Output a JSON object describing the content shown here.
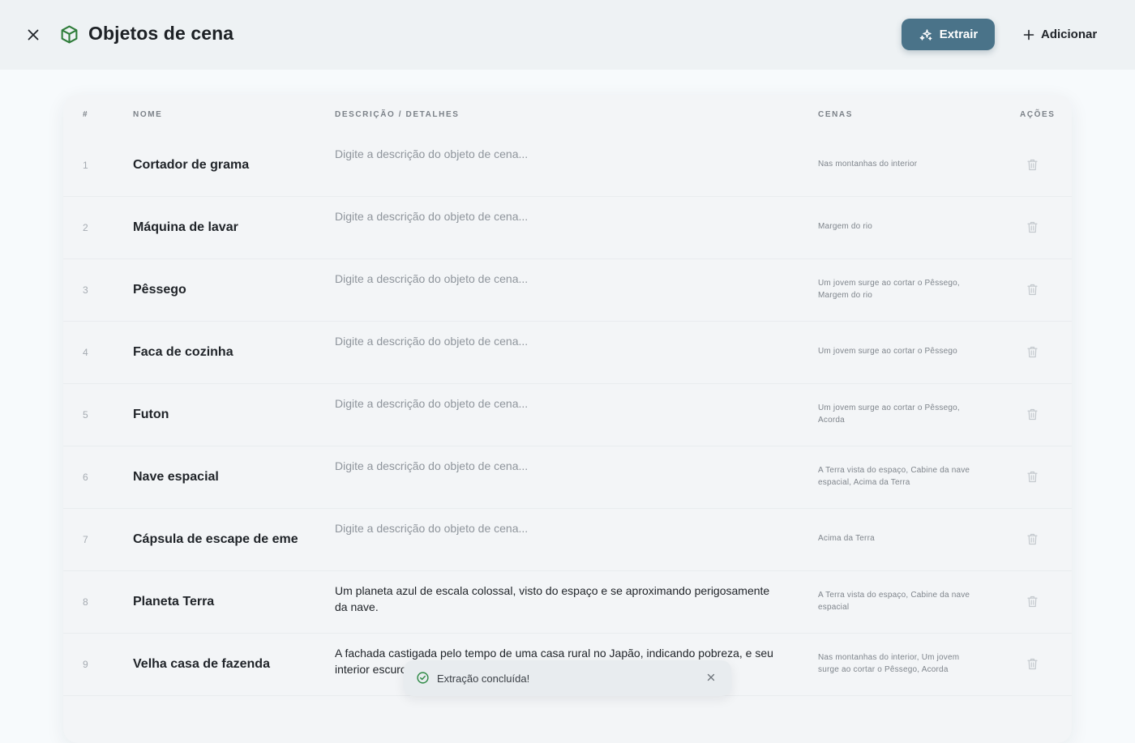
{
  "header": {
    "title": "Objetos de cena",
    "extract_label": "Extrair",
    "add_label": "Adicionar"
  },
  "colors": {
    "accent": "#4a7389",
    "title_icon": "#2f7d3a",
    "toast_icon": "#2f8a46"
  },
  "icons": {
    "close": "close-icon",
    "title": "cube-icon",
    "extract": "sparkles-icon",
    "add": "plus-icon",
    "delete": "trash-icon",
    "toast_status": "check-circle-icon",
    "toast_close": "close-icon"
  },
  "table": {
    "columns": {
      "index": "#",
      "name": "NOME",
      "description": "DESCRIÇÃO / DETALHES",
      "scenes": "CENAS",
      "actions": "AÇÕES"
    },
    "description_placeholder": "Digite a descrição do objeto de cena...",
    "rows": [
      {
        "index": "1",
        "name": "Cortador de grama",
        "description": "",
        "scenes": "Nas montanhas do interior"
      },
      {
        "index": "2",
        "name": "Máquina de lavar",
        "description": "",
        "scenes": "Margem do rio"
      },
      {
        "index": "3",
        "name": "Pêssego",
        "description": "",
        "scenes": "Um jovem surge ao cortar o Pêssego, Margem do rio"
      },
      {
        "index": "4",
        "name": "Faca de cozinha",
        "description": "",
        "scenes": "Um jovem surge ao cortar o Pêssego"
      },
      {
        "index": "5",
        "name": "Futon",
        "description": "",
        "scenes": "Um jovem surge ao cortar o Pêssego, Acorda"
      },
      {
        "index": "6",
        "name": "Nave espacial",
        "description": "",
        "scenes": "A Terra vista do espaço, Cabine da nave espacial, Acima da Terra"
      },
      {
        "index": "7",
        "name": "Cápsula de escape de emer",
        "description": "",
        "scenes": "Acima da Terra"
      },
      {
        "index": "8",
        "name": "Planeta Terra",
        "description": "Um planeta azul de escala colossal, visto do espaço e se aproximando perigosamente da nave.",
        "scenes": "A Terra vista do espaço, Cabine da nave espacial"
      },
      {
        "index": "9",
        "name": "Velha casa de fazenda",
        "description": "A fachada castigada pelo tempo de uma casa rural no Japão, indicando pobreza, e seu interior escuro",
        "scenes": "Nas montanhas do interior, Um jovem surge ao cortar o Pêssego, Acorda"
      }
    ]
  },
  "toast": {
    "message": "Extração concluída!"
  }
}
